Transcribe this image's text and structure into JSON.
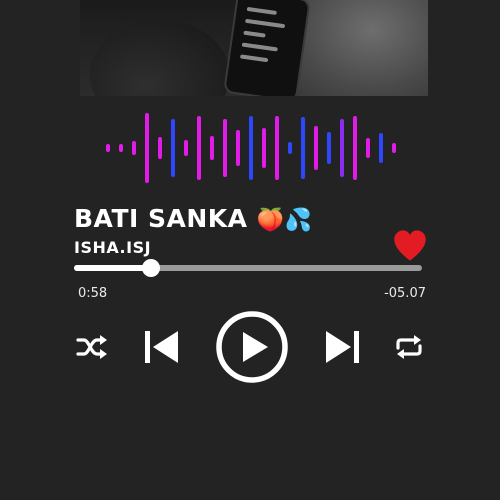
{
  "track": {
    "title": "BATI SANKA",
    "title_emojis": "🍑💦",
    "artist": "ISHA.ISJ",
    "liked": true,
    "progress": 0.22
  },
  "times": {
    "elapsed": "0:58",
    "remaining": "-05.07"
  },
  "icons": {
    "like": "heart-icon",
    "shuffle": "shuffle-icon",
    "previous": "skip-previous-icon",
    "play": "play-icon",
    "next": "skip-next-icon",
    "repeat": "repeat-icon"
  },
  "colors": {
    "background": "#232323",
    "heart": "#e31b23",
    "wave_magenta": "#e21ce8",
    "wave_purple": "#8b2cf0",
    "wave_blue": "#2f46ff"
  }
}
